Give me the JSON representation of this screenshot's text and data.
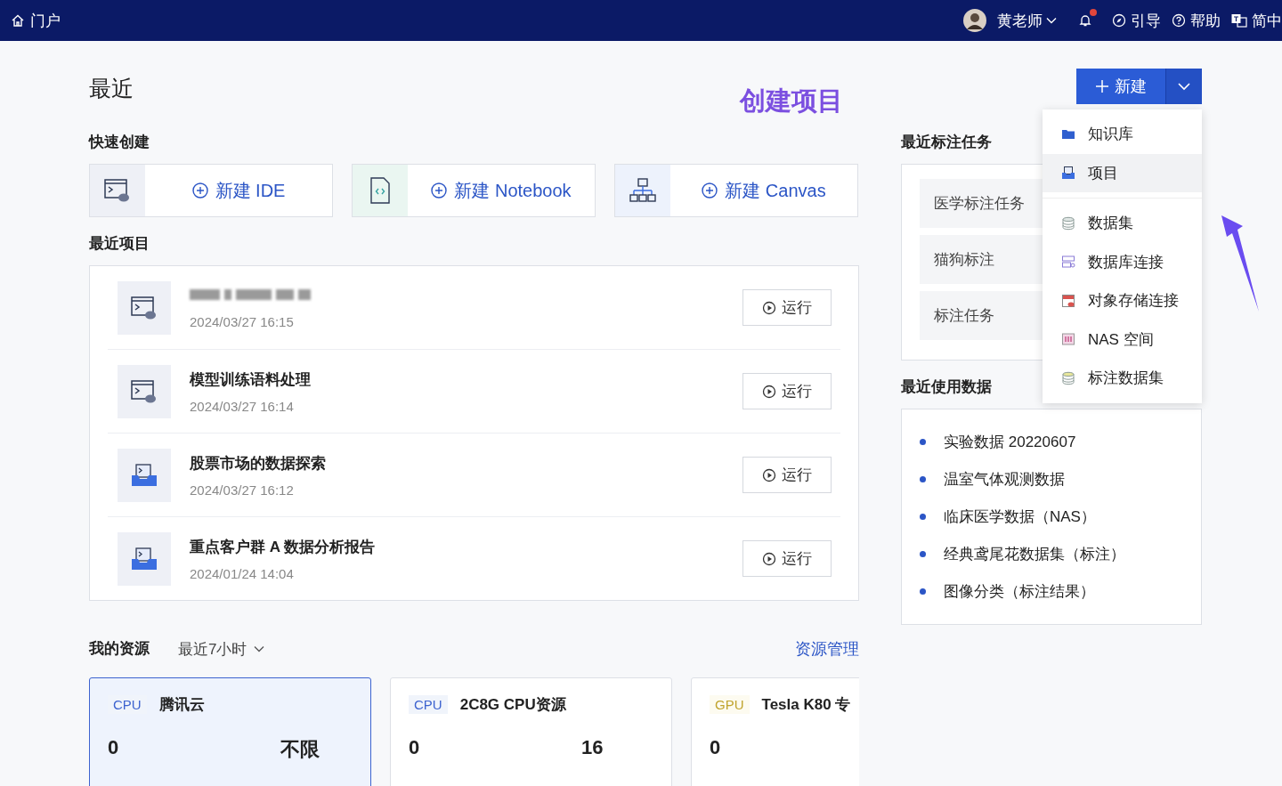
{
  "header": {
    "home": "门户",
    "user": "黄老师",
    "notification_dot": true,
    "links": [
      {
        "label": "引导",
        "kind": "guide"
      },
      {
        "label": "帮助",
        "kind": "help"
      },
      {
        "label": "简中",
        "kind": "lang"
      }
    ]
  },
  "title": "最近",
  "annotation": "创建项目",
  "new_button": {
    "label": "新建",
    "expanded": true
  },
  "new_menu": {
    "groups": [
      [
        {
          "label": "知识库",
          "kind": "folder",
          "selected": false
        },
        {
          "label": "项目",
          "kind": "project",
          "selected": true
        }
      ],
      [
        {
          "label": "数据集",
          "kind": "dataset",
          "selected": false
        },
        {
          "label": "数据库连接",
          "kind": "database",
          "selected": false
        },
        {
          "label": "对象存储连接",
          "kind": "storage",
          "selected": false
        },
        {
          "label": "NAS 空间",
          "kind": "nas",
          "selected": false
        },
        {
          "label": "标注数据集",
          "kind": "labelset",
          "selected": false
        }
      ]
    ]
  },
  "quick_create": {
    "title": "快速创建",
    "items": [
      {
        "label": "新建 IDE",
        "kind": "ide"
      },
      {
        "label": "新建 Notebook",
        "kind": "notebook"
      },
      {
        "label": "新建 Canvas",
        "kind": "canvas"
      }
    ]
  },
  "recent_projects": {
    "title": "最近项目",
    "rows": [
      {
        "redacted": true,
        "time": "2024/03/27 16:15",
        "kind": "ide",
        "run": "运行"
      },
      {
        "redacted": false,
        "name": "模型训练语料处理",
        "time": "2024/03/27 16:14",
        "kind": "ide",
        "run": "运行"
      },
      {
        "redacted": false,
        "name": "股票市场的数据探索",
        "time": "2024/03/27 16:12",
        "kind": "notebook",
        "run": "运行"
      },
      {
        "redacted": false,
        "name": "重点客户群 A 数据分析报告",
        "time": "2024/01/24 14:04",
        "kind": "notebook",
        "run": "运行"
      }
    ]
  },
  "resources": {
    "title": "我的资源",
    "range": "最近7小时",
    "manage_link": "资源管理",
    "cards": [
      {
        "type": "CPU",
        "name": "腾讯云",
        "used": "0",
        "quota": "不限",
        "selected": true
      },
      {
        "type": "CPU",
        "name": "2C8G CPU资源",
        "used": "0",
        "quota": "16",
        "selected": false
      },
      {
        "type": "GPU",
        "name": "Tesla K80 专",
        "used": "0",
        "selected": false
      }
    ]
  },
  "label_tasks": {
    "title": "最近标注任务",
    "items": [
      "医学标注任务",
      "猫狗标注",
      "标注任务"
    ]
  },
  "recent_data": {
    "title": "最近使用数据",
    "items": [
      "实验数据 20220607",
      "温室气体观测数据",
      "临床医学数据（NAS）",
      "经典鸢尾花数据集（标注）",
      "图像分类（标注结果）"
    ]
  }
}
